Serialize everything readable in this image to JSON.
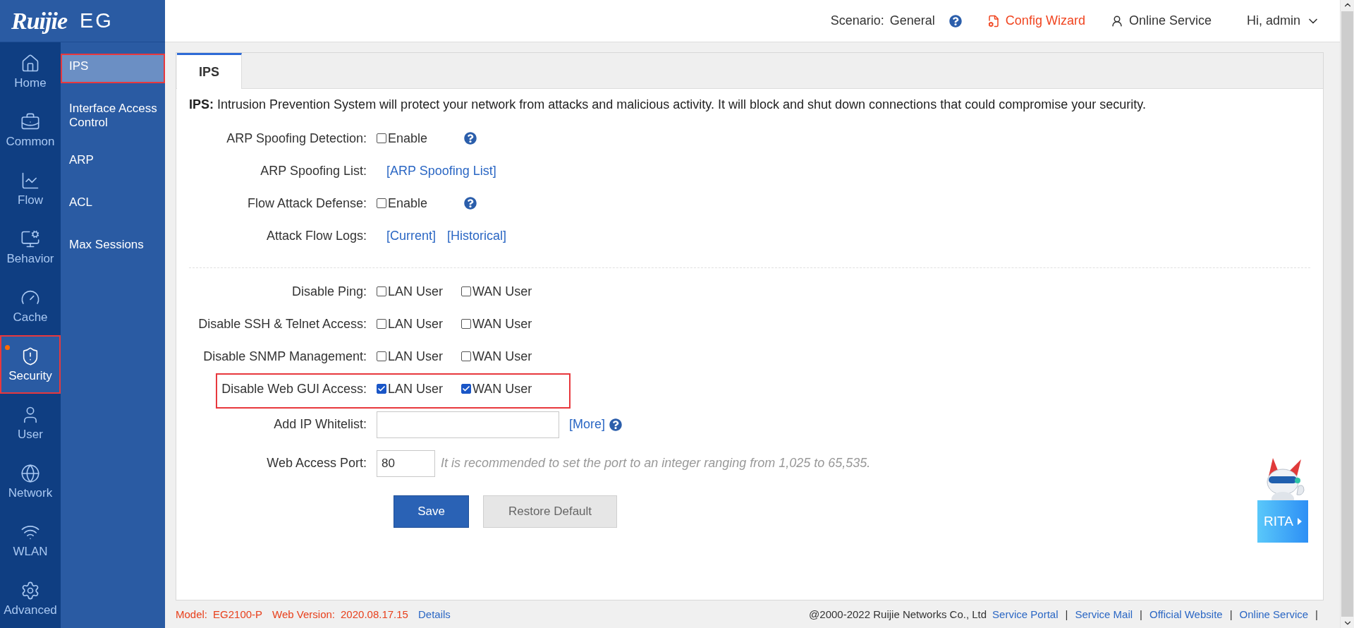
{
  "brand": {
    "logo": "Ruijie",
    "product": "EG"
  },
  "nav": [
    {
      "label": "Home",
      "selected": false,
      "highlighted": false,
      "dot": false
    },
    {
      "label": "Common",
      "selected": false,
      "highlighted": false,
      "dot": false
    },
    {
      "label": "Flow",
      "selected": false,
      "highlighted": false,
      "dot": false
    },
    {
      "label": "Behavior",
      "selected": false,
      "highlighted": false,
      "dot": false
    },
    {
      "label": "Cache",
      "selected": false,
      "highlighted": false,
      "dot": false
    },
    {
      "label": "Security",
      "selected": true,
      "highlighted": true,
      "dot": true
    },
    {
      "label": "User",
      "selected": false,
      "highlighted": false,
      "dot": false
    },
    {
      "label": "Network",
      "selected": false,
      "highlighted": false,
      "dot": false
    },
    {
      "label": "WLAN",
      "selected": false,
      "highlighted": false,
      "dot": false
    },
    {
      "label": "Advanced",
      "selected": false,
      "highlighted": false,
      "dot": false
    }
  ],
  "submenu": [
    {
      "label": "IPS",
      "selected": true,
      "highlighted": true
    },
    {
      "label": "Interface Access Control",
      "selected": false,
      "highlighted": false
    },
    {
      "label": "ARP",
      "selected": false,
      "highlighted": false
    },
    {
      "label": "ACL",
      "selected": false,
      "highlighted": false
    },
    {
      "label": "Max Sessions",
      "selected": false,
      "highlighted": false
    }
  ],
  "header": {
    "scenario_label": "Scenario:",
    "scenario_value": "General",
    "config_wizard": "Config Wizard",
    "online_service": "Online Service",
    "user": "Hi, admin"
  },
  "tabs": [
    {
      "label": "IPS",
      "selected": true
    }
  ],
  "intro": "**IPS:**  Intrusion Prevention System will protect your network from attacks and malicious activity. It will block and shut down connections that could compromise your security.",
  "form": [
    {
      "kind": "checks",
      "label": "ARP Spoofing Detection:",
      "options": [
        {
          "label": "Enable",
          "checked": false
        }
      ],
      "help": true,
      "highlighted": false
    },
    {
      "kind": "links",
      "label": "ARP Spoofing List:",
      "links": [
        "[ARP Spoofing List]"
      ]
    },
    {
      "kind": "checks",
      "label": "Flow Attack Defense:",
      "options": [
        {
          "label": "Enable",
          "checked": false
        }
      ],
      "help": true,
      "highlighted": false
    },
    {
      "kind": "links",
      "label": "Attack Flow Logs:",
      "links": [
        "[Current]",
        "[Historical]"
      ]
    },
    {
      "kind": "divider"
    },
    {
      "kind": "checks",
      "label": "Disable Ping:",
      "options": [
        {
          "label": "LAN User",
          "checked": false
        },
        {
          "label": "WAN User",
          "checked": false
        }
      ],
      "help": false,
      "highlighted": false
    },
    {
      "kind": "checks",
      "label": "Disable SSH & Telnet Access:",
      "options": [
        {
          "label": "LAN User",
          "checked": false
        },
        {
          "label": "WAN User",
          "checked": false
        }
      ],
      "help": false,
      "highlighted": false
    },
    {
      "kind": "checks",
      "label": "Disable SNMP Management:",
      "options": [
        {
          "label": "LAN User",
          "checked": false
        },
        {
          "label": "WAN User",
          "checked": false
        }
      ],
      "help": false,
      "highlighted": false
    },
    {
      "kind": "checks",
      "label": "Disable Web GUI Access:",
      "options": [
        {
          "label": "LAN User",
          "checked": true
        },
        {
          "label": "WAN User",
          "checked": true
        }
      ],
      "help": false,
      "highlighted": true
    },
    {
      "kind": "input",
      "label": "Add IP Whitelist:",
      "links": [
        "[More]"
      ],
      "help": true
    },
    {
      "kind": "input",
      "label": "Web Access Port:",
      "value": "80",
      "hint": "It is recommended to set the port to an integer ranging from 1,025 to 65,535.",
      "help": false
    },
    {
      "kind": "buttons",
      "buttons": [
        {
          "label": "Save",
          "kind": "primary"
        },
        {
          "label": "Restore Default",
          "kind": "secondary"
        }
      ]
    }
  ],
  "assistant": {
    "label": "RITA"
  },
  "footer": {
    "model_label": "Model:",
    "model": "EG2100-P",
    "version_label": "Web Version:",
    "version": "2020.08.17.15",
    "details": "Details",
    "copyright": "@2000-2022 Ruijie Networks Co., Ltd",
    "links": [
      {
        "label": "Service Portal",
        "separator": "|"
      },
      {
        "label": "Service Mail",
        "separator": "|"
      },
      {
        "label": "Official Website",
        "separator": "|"
      },
      {
        "label": "Online Service",
        "separator": "|"
      }
    ]
  }
}
